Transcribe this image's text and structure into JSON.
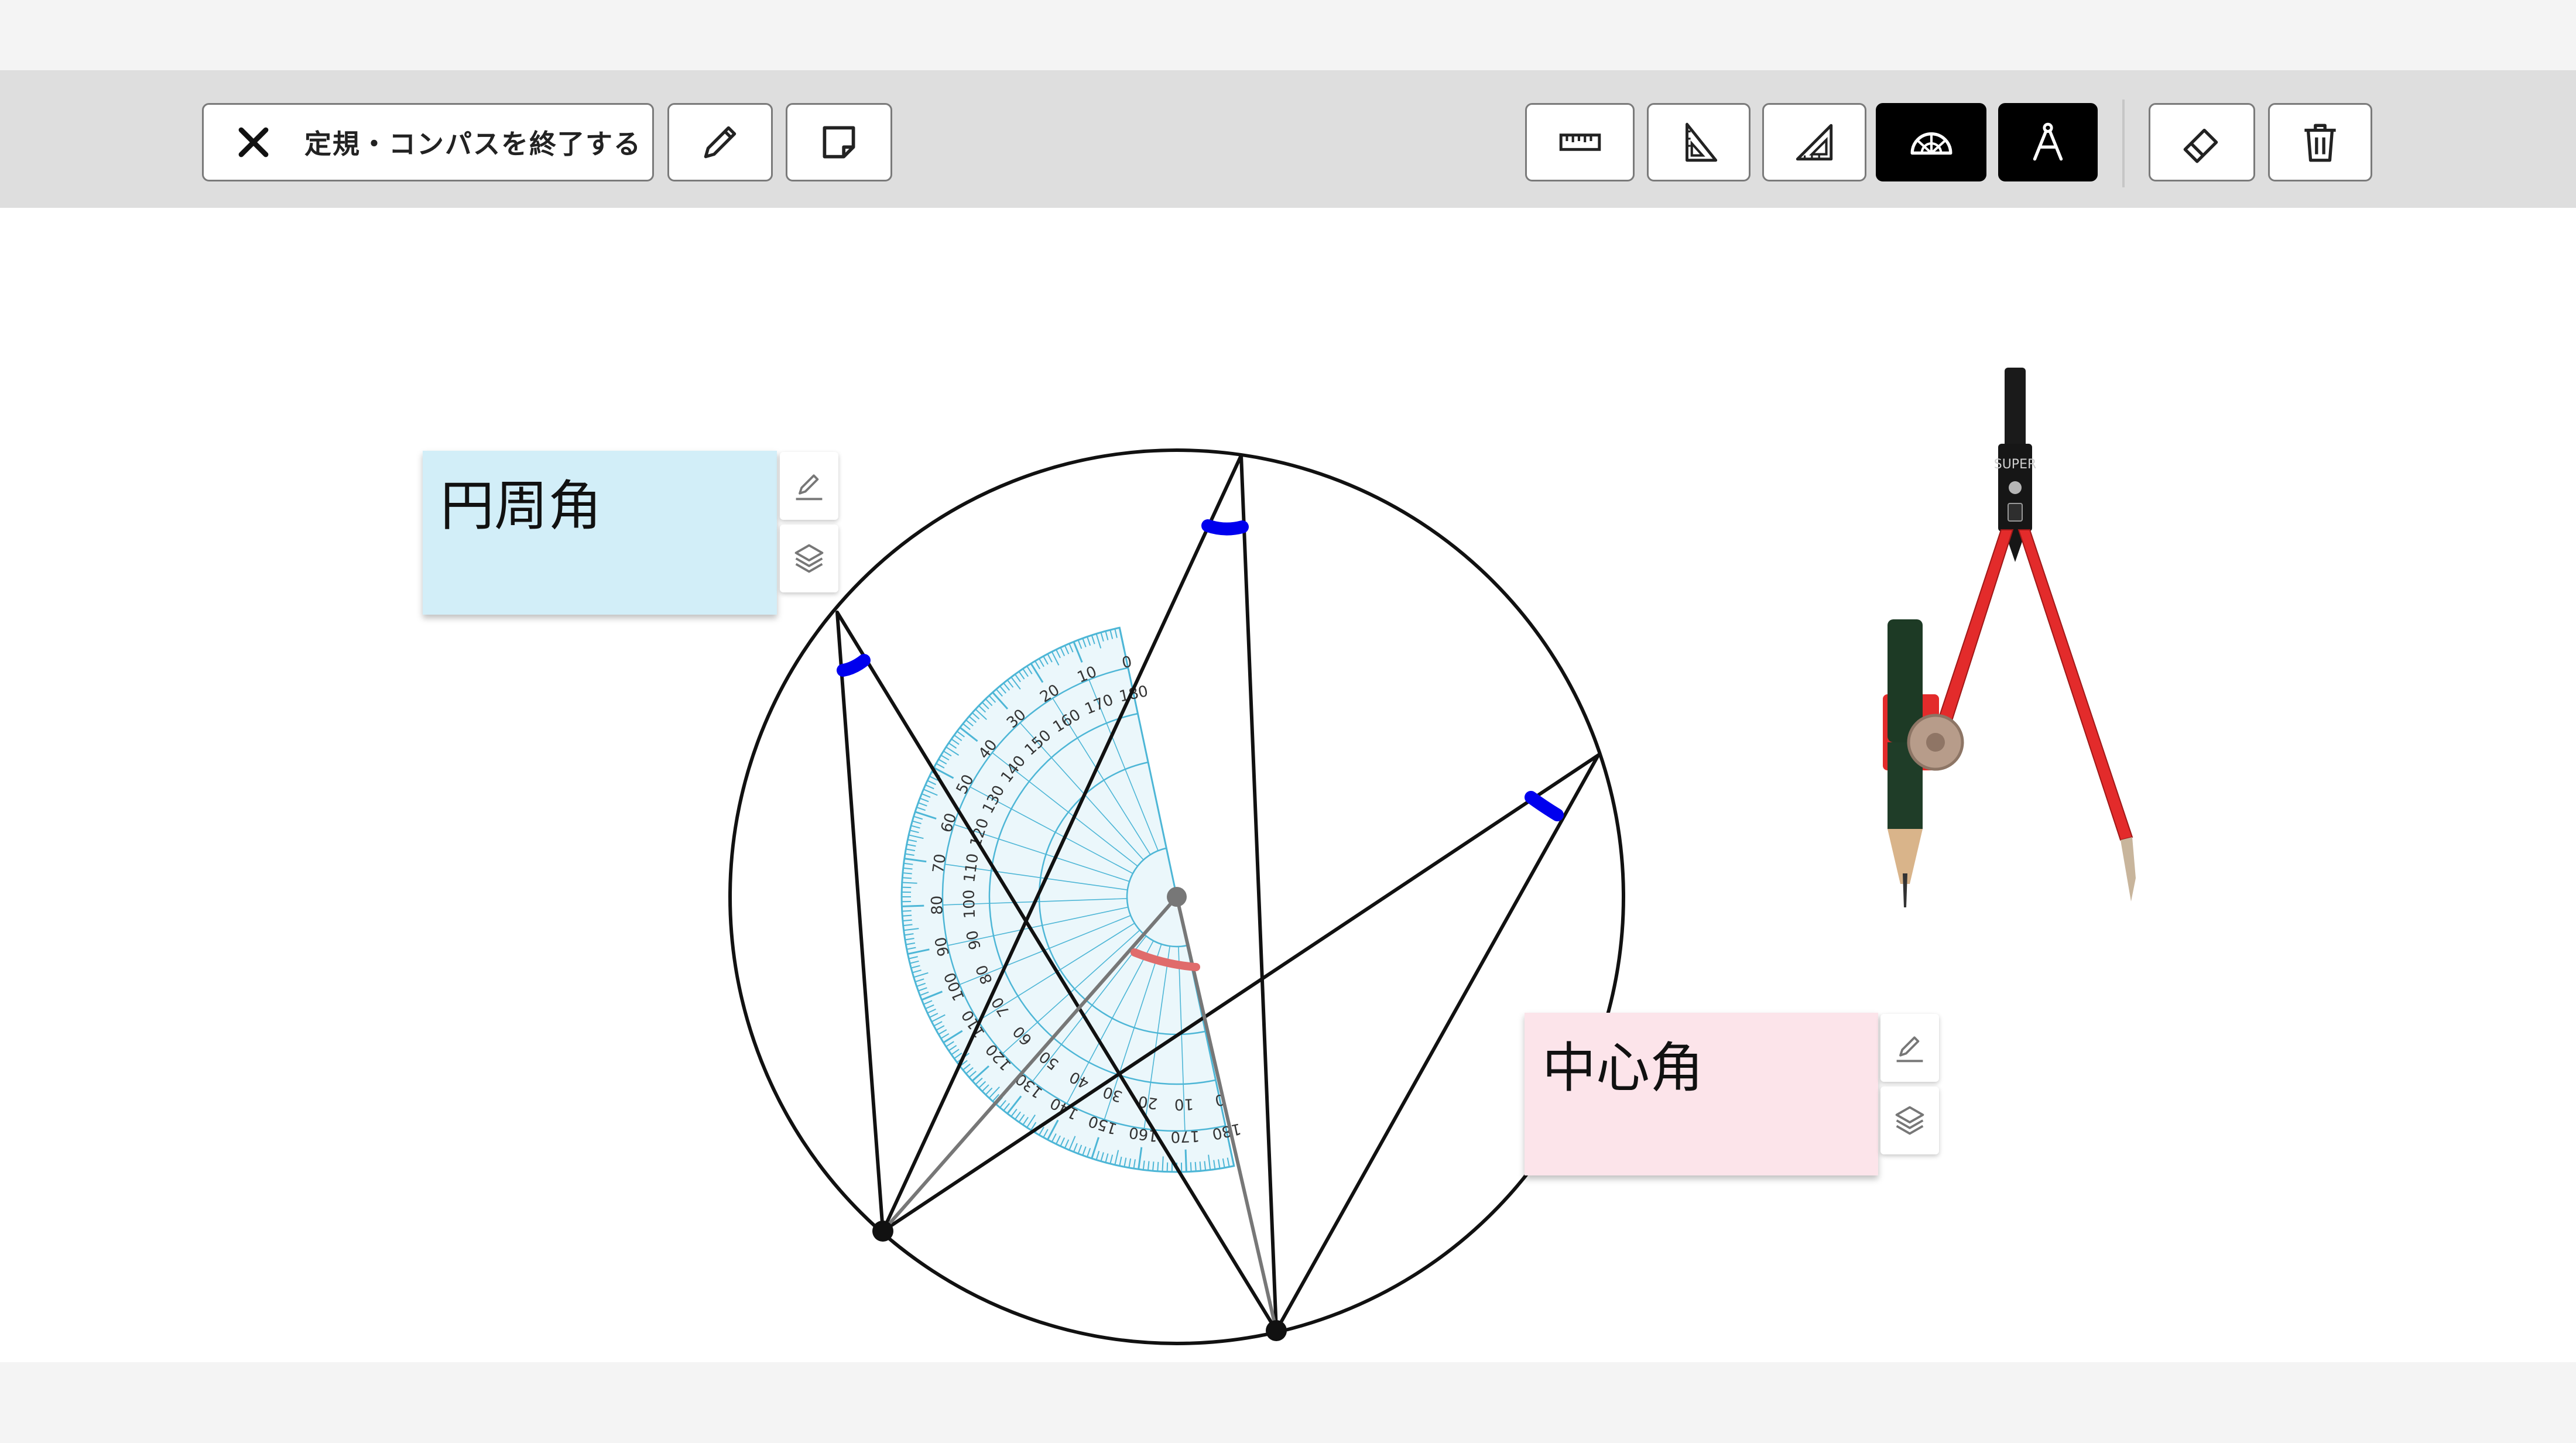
{
  "toolbar": {
    "exit_label": "定規・コンパスを終了する",
    "buttons": [
      {
        "name": "pen",
        "icon": "pencil-icon",
        "active": false
      },
      {
        "name": "sticky-note",
        "icon": "sticky-note-icon",
        "active": false
      },
      {
        "name": "ruler",
        "icon": "ruler-icon",
        "active": false
      },
      {
        "name": "set-square-right",
        "icon": "triangle-ruler-icon",
        "active": false
      },
      {
        "name": "set-square-45",
        "icon": "triangle-ruler-45-icon",
        "active": false
      },
      {
        "name": "protractor",
        "icon": "protractor-icon",
        "active": true
      },
      {
        "name": "compass",
        "icon": "compass-icon",
        "active": true
      },
      {
        "name": "eraser",
        "icon": "eraser-icon",
        "active": false
      },
      {
        "name": "delete",
        "icon": "trash-icon",
        "active": false
      }
    ]
  },
  "notes": [
    {
      "text": "円周角",
      "color": "#d2eef8"
    },
    {
      "text": "中心角",
      "color": "#fce4ea"
    }
  ],
  "compass_brand": "SUPER",
  "protractor": {
    "outer_labels": [
      "0",
      "10",
      "20",
      "30",
      "40",
      "50",
      "60",
      "70",
      "80",
      "90",
      "100",
      "110",
      "120",
      "130",
      "140",
      "150",
      "160",
      "170",
      "180"
    ],
    "inner_labels": [
      "180",
      "170",
      "160",
      "150",
      "140",
      "130",
      "120",
      "110",
      "100",
      "90",
      "80",
      "70",
      "60",
      "50",
      "40",
      "30",
      "20",
      "10",
      "0"
    ]
  },
  "colors": {
    "toolbar_bg": "#dedede",
    "canvas_bg": "#ffffff",
    "active_button": "#000000",
    "angle_mark_blue": "#0000ee",
    "angle_mark_red": "#e06b6b",
    "protractor_blue": "#5bc0de",
    "compass_red": "#e32b2b"
  }
}
